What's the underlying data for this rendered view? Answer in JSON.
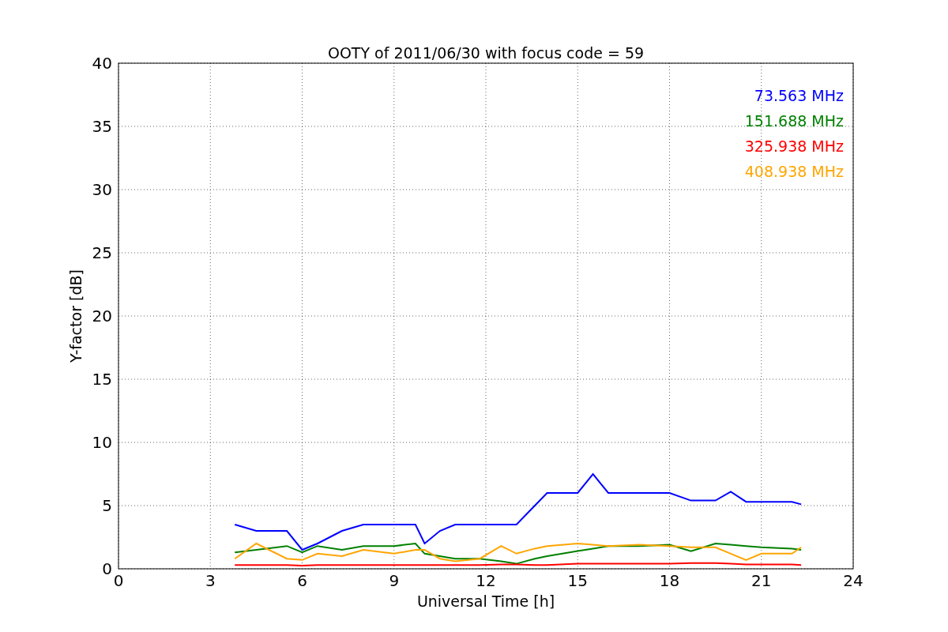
{
  "chart_data": {
    "type": "line",
    "title": "OOTY of 2011/06/30 with focus code = 59",
    "xlabel": "Universal Time [h]",
    "ylabel": "Y-factor [dB]",
    "x": [
      3.8,
      4.5,
      5.5,
      6,
      6.5,
      7.3,
      8,
      9,
      9.7,
      10,
      10.5,
      11,
      11.8,
      12.5,
      13,
      13.6,
      14,
      15,
      15.5,
      16,
      17,
      18,
      18.7,
      19.5,
      20,
      20.5,
      21,
      22,
      22.3
    ],
    "series": [
      {
        "name": "73.563 MHz",
        "color": "#0000ff",
        "values": [
          3.5,
          3,
          3,
          1.5,
          2,
          3,
          3.5,
          3.5,
          3.5,
          2,
          3,
          3.5,
          3.5,
          3.5,
          3.5,
          5,
          6,
          6,
          7.5,
          6,
          6,
          6,
          5.4,
          5.4,
          6.1,
          5.3,
          5.3,
          5.3,
          5.1
        ]
      },
      {
        "name": "151.688 MHz",
        "color": "#008000",
        "values": [
          1.3,
          1.5,
          1.8,
          1.3,
          1.8,
          1.5,
          1.8,
          1.8,
          2,
          1.2,
          1,
          0.8,
          0.8,
          0.6,
          0.4,
          0.8,
          1,
          1.4,
          1.6,
          1.8,
          1.8,
          1.9,
          1.4,
          2,
          1.9,
          1.8,
          1.7,
          1.6,
          1.5
        ]
      },
      {
        "name": "325.938 MHz",
        "color": "#ff0000",
        "values": [
          0.3,
          0.3,
          0.3,
          0.25,
          0.3,
          0.3,
          0.3,
          0.3,
          0.3,
          0.3,
          0.3,
          0.3,
          0.3,
          0.35,
          0.35,
          0.3,
          0.3,
          0.4,
          0.4,
          0.4,
          0.4,
          0.4,
          0.45,
          0.45,
          0.4,
          0.35,
          0.35,
          0.35,
          0.3
        ]
      },
      {
        "name": "408.938 MHz",
        "color": "#ffa500",
        "values": [
          0.8,
          2,
          0.8,
          0.7,
          1.2,
          1,
          1.5,
          1.2,
          1.5,
          1.5,
          0.8,
          0.6,
          0.8,
          1.8,
          1.2,
          1.6,
          1.8,
          2,
          1.9,
          1.8,
          1.9,
          1.8,
          1.7,
          1.7,
          1.2,
          0.7,
          1.2,
          1.2,
          1.7
        ]
      }
    ],
    "grid": true,
    "xlim": [
      0,
      24
    ],
    "ylim": [
      0,
      40
    ],
    "xticks": [
      0,
      3,
      6,
      9,
      12,
      15,
      18,
      21,
      24
    ],
    "yticks": [
      0,
      5,
      10,
      15,
      20,
      25,
      30,
      35,
      40
    ]
  }
}
